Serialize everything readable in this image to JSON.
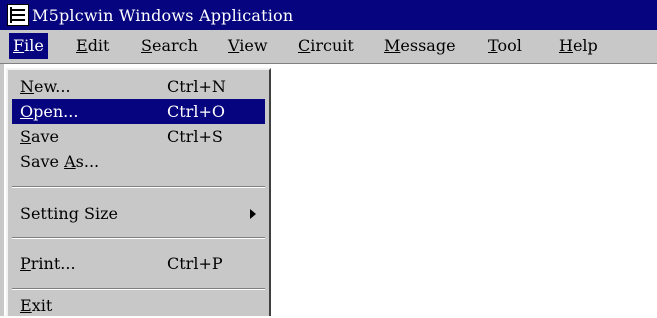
{
  "window": {
    "title": "M5plcwin Windows Application",
    "icon": "app-document-icon"
  },
  "menubar": {
    "items": [
      {
        "mnemonic": "F",
        "rest": "ile"
      },
      {
        "mnemonic": "E",
        "rest": "dit"
      },
      {
        "mnemonic": "S",
        "rest": "earch"
      },
      {
        "mnemonic": "V",
        "rest": "iew"
      },
      {
        "mnemonic": "C",
        "rest": "ircuit"
      },
      {
        "mnemonic": "M",
        "rest": "essage"
      },
      {
        "mnemonic": "T",
        "rest": "ool"
      },
      {
        "mnemonic": "H",
        "rest": "elp"
      }
    ]
  },
  "file_menu": {
    "items": [
      {
        "pre": "",
        "mnemonic": "N",
        "rest": "ew...",
        "shortcut": "Ctrl+N"
      },
      {
        "pre": "",
        "mnemonic": "O",
        "rest": "pen...",
        "shortcut": "Ctrl+O"
      },
      {
        "pre": "",
        "mnemonic": "S",
        "rest": "ave",
        "shortcut": "Ctrl+S"
      },
      {
        "pre": "Save ",
        "mnemonic": "A",
        "rest": "s...",
        "shortcut": ""
      },
      {
        "pre": "Setting Size",
        "mnemonic": "",
        "rest": "",
        "shortcut": ""
      },
      {
        "pre": "",
        "mnemonic": "P",
        "rest": "rint...",
        "shortcut": "Ctrl+P"
      },
      {
        "pre": "",
        "mnemonic": "E",
        "rest": "xit",
        "shortcut": ""
      }
    ],
    "highlighted_item": "Open...",
    "submenu_arrow_icon": "triangle-right-icon"
  },
  "colors": {
    "title_bar": "#06047e",
    "highlight": "#06047e",
    "menu_face": "#c8c8c8"
  }
}
